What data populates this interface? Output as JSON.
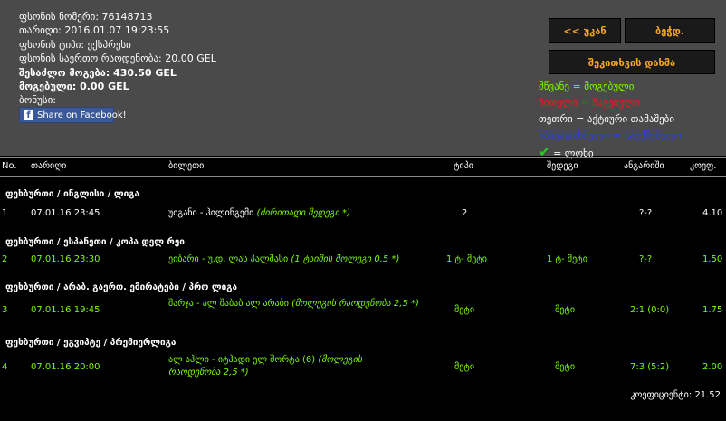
{
  "info": {
    "ticket_number": "ფსონის ნომერი: 76148713",
    "date": "თარიღი: 2016.01.07 19:23:55",
    "bet_type": "ფსონის ტიპი: ექსპრესი",
    "total_stake": "ფსონის საერთო რაოდენობა: 20.00 GEL",
    "possible_win": "შესაძლო მოგება: 430.50 GEL",
    "won": "მოგებული: 0.00 GEL",
    "bonus": "ბონუსი:"
  },
  "facebook": {
    "label": "Share on Facebook!",
    "icon": "facebook-icon"
  },
  "buttons": {
    "back": "<< უკან",
    "print": "ბეჭდ.",
    "bet_again": "შეკითხვის დახმა"
  },
  "legend": {
    "green": "მწვანე = მოგებული",
    "red": "წითელი = წაგებული",
    "white": "თეთრი = აქტიური თამაშები",
    "blue": "ხაზგადასმული = გაუქმებული",
    "check": "= ლოხი",
    "colors": {
      "green": "#7cfc00",
      "red": "#e02020",
      "blue": "#2f3fd0"
    }
  },
  "columns": {
    "no": "No.",
    "date": "თარიღი",
    "event": "ბილეთი",
    "type": "ტიპი",
    "pick": "შედეგი",
    "score": "ანგარიში",
    "odds": "კოეფ."
  },
  "groups": [
    {
      "title": "ფეხბურთი / ინგლისი / ლიგა",
      "row": {
        "no": "1",
        "date": "07.01.16 23:45",
        "event": "უიგანი - ჰილინგემი",
        "event_note": "(ძირითადი შედეგი *)",
        "type": "2",
        "pick": "",
        "score": "?-?",
        "odds": "4.10",
        "status": "active"
      }
    },
    {
      "title": "ფეხბურთი / ესპანეთი / კოპა დელ რეი",
      "row": {
        "no": "2",
        "date": "07.01.16 23:30",
        "event": "ეიბარი - უ.დ. ლას პალმასი",
        "event_note": "(1 ტაიმის მოლეგი 0.5 *)",
        "type": "1 ტ- მეტი",
        "pick": "1 ტ- მეტი",
        "score": "?-?",
        "odds": "1.50",
        "status": "won"
      }
    },
    {
      "title": "ფეხბურთი / არაბ. გაერთ. ემირატები / პრო ლიგა",
      "row": {
        "no": "3",
        "date": "07.01.16 19:45",
        "event": "შარჯა - ალ შაბაბ ალ არაბი",
        "event_note": "(მოლეგის რაოდენობა 2,5 *)",
        "type": "მეტი",
        "pick": "მეტი",
        "score": "2:1 (0:0)",
        "odds": "1.75",
        "status": "won"
      }
    },
    {
      "title": "ფეხბურთი / ეგვიპტე / პრემიერლიგა",
      "row": {
        "no": "4",
        "date": "07.01.16 20:00",
        "event": "ალ აჰლი - იტჰადი ელ შორტა (6)",
        "event_note": "(მოლეგის რაოდენობა 2,5 *)",
        "type": "მეტი",
        "pick": "მეტი",
        "score": "7:3 (5:2)",
        "odds": "2.00",
        "status": "won"
      }
    }
  ],
  "total": "კოეფიციენტი: 21.52"
}
